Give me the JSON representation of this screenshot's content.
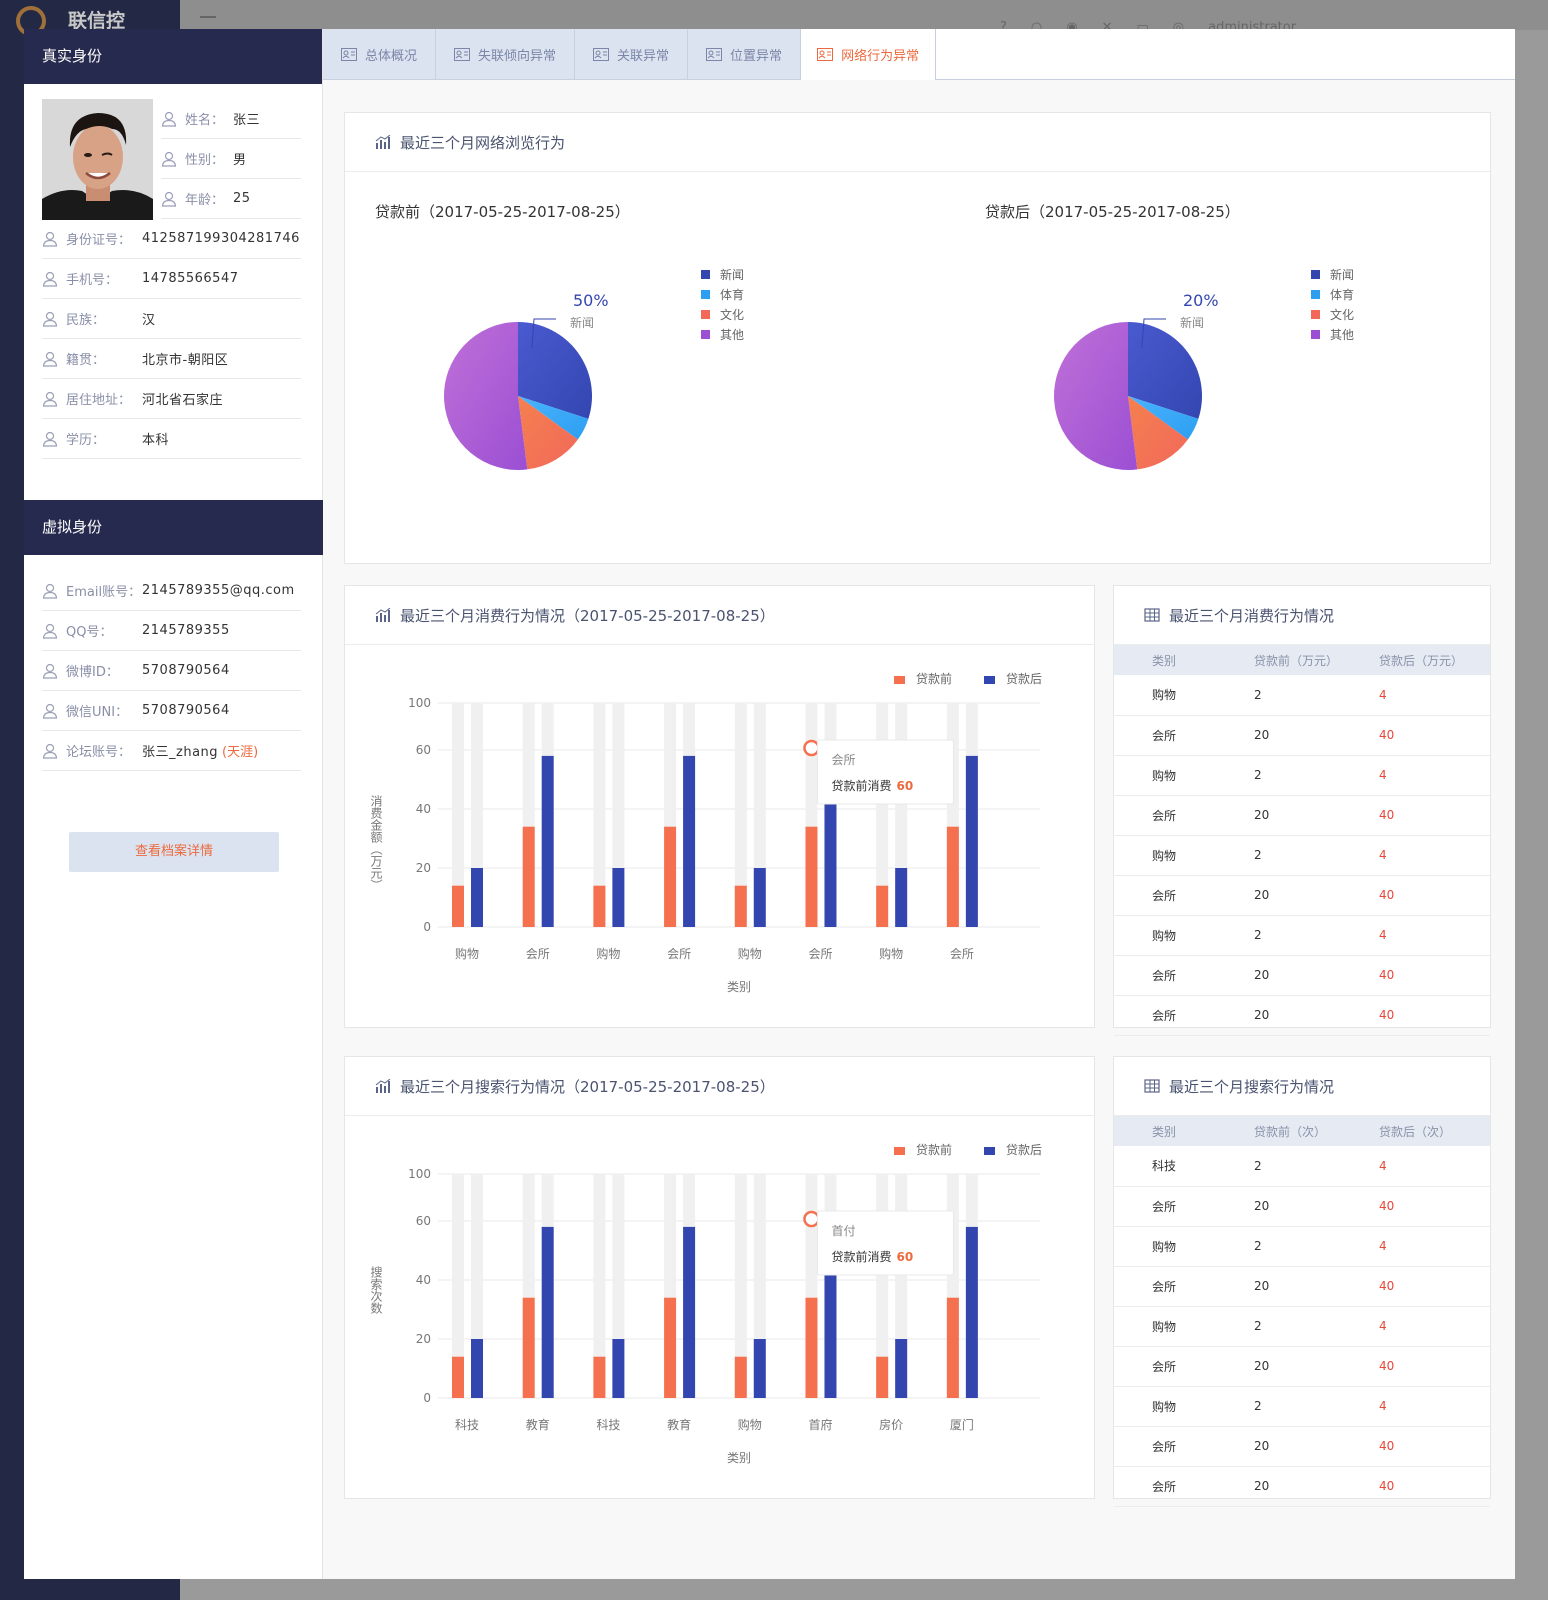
{
  "app": {
    "brand": "联信控",
    "user": "administrator"
  },
  "real_identity": {
    "title": "真实身份",
    "basic": [
      {
        "label": "姓名：",
        "value": "张三"
      },
      {
        "label": "性别：",
        "value": "男"
      },
      {
        "label": "年龄：",
        "value": "25"
      }
    ],
    "fields": [
      {
        "label": "身份证号：",
        "value": "412587199304281746"
      },
      {
        "label": "手机号：",
        "value": "14785566547"
      },
      {
        "label": "民族：",
        "value": "汉"
      },
      {
        "label": "籍贯：",
        "value": "北京市-朝阳区"
      },
      {
        "label": "居住地址：",
        "value": "河北省石家庄"
      },
      {
        "label": "学历：",
        "value": "本科"
      }
    ]
  },
  "virtual_identity": {
    "title": "虚拟身份",
    "fields": [
      {
        "label": "Email账号：",
        "value": "2145789355@qq.com"
      },
      {
        "label": "QQ号：",
        "value": "2145789355"
      },
      {
        "label": "微博ID：",
        "value": "5708790564"
      },
      {
        "label": "微信UNI：",
        "value": "5708790564"
      },
      {
        "label": "论坛账号：",
        "value": "张三_zhang",
        "extra": "(天涯)"
      }
    ]
  },
  "detail_button": "查看档案详情",
  "tabs": [
    {
      "label": "总体概况",
      "active": false
    },
    {
      "label": "失联倾向异常",
      "active": false
    },
    {
      "label": "关联异常",
      "active": false
    },
    {
      "label": "位置异常",
      "active": false
    },
    {
      "label": "网络行为异常",
      "active": true
    }
  ],
  "browse": {
    "title": "最近三个月网络浏览行为",
    "before_title": "贷款前（2017-05-25-2017-08-25）",
    "after_title": "贷款后（2017-05-25-2017-08-25）",
    "legend": [
      "新闻",
      "体育",
      "文化",
      "其他"
    ],
    "colors": [
      "#3346b0",
      "#2d9ef0",
      "#f2695a",
      "#9b4fd3"
    ],
    "before_label": {
      "pct": "50%",
      "name": "新闻"
    },
    "after_label": {
      "pct": "20%",
      "name": "新闻"
    }
  },
  "consume": {
    "title": "最近三个月消费行为情况（2017-05-25-2017-08-25）",
    "legend": [
      "贷款前",
      "贷款后"
    ],
    "ylabel": "消费金额（万元）",
    "xlabel": "类别",
    "tooltip": {
      "name": "会所",
      "label": "贷款前消费",
      "value": "60"
    },
    "table_title": "最近三个月消费行为情况",
    "table_headers": [
      "类别",
      "贷款前（万元）",
      "贷款后（万元）"
    ],
    "table_rows": [
      [
        "购物",
        "2",
        "4"
      ],
      [
        "会所",
        "20",
        "40"
      ],
      [
        "购物",
        "2",
        "4"
      ],
      [
        "会所",
        "20",
        "40"
      ],
      [
        "购物",
        "2",
        "4"
      ],
      [
        "会所",
        "20",
        "40"
      ],
      [
        "购物",
        "2",
        "4"
      ],
      [
        "会所",
        "20",
        "40"
      ],
      [
        "会所",
        "20",
        "40"
      ]
    ]
  },
  "search": {
    "title": "最近三个月搜索行为情况（2017-05-25-2017-08-25）",
    "legend": [
      "贷款前",
      "贷款后"
    ],
    "ylabel": "搜索次数",
    "xlabel": "类别",
    "tooltip": {
      "name": "首付",
      "label": "贷款前消费",
      "value": "60"
    },
    "table_title": "最近三个月搜索行为情况",
    "table_headers": [
      "类别",
      "贷款前（次）",
      "贷款后（次）"
    ],
    "table_rows": [
      [
        "科技",
        "2",
        "4"
      ],
      [
        "会所",
        "20",
        "40"
      ],
      [
        "购物",
        "2",
        "4"
      ],
      [
        "会所",
        "20",
        "40"
      ],
      [
        "购物",
        "2",
        "4"
      ],
      [
        "会所",
        "20",
        "40"
      ],
      [
        "购物",
        "2",
        "4"
      ],
      [
        "会所",
        "20",
        "40"
      ],
      [
        "会所",
        "20",
        "40"
      ]
    ]
  },
  "chart_data": [
    {
      "type": "pie",
      "title": "贷款前（2017-05-25-2017-08-25）",
      "categories": [
        "新闻",
        "体育",
        "文化",
        "其他"
      ],
      "values": [
        30,
        5,
        13,
        52
      ],
      "label_visible": "50% 新闻"
    },
    {
      "type": "pie",
      "title": "贷款后（2017-05-25-2017-08-25）",
      "categories": [
        "新闻",
        "体育",
        "文化",
        "其他"
      ],
      "values": [
        30,
        5,
        13,
        52
      ],
      "label_visible": "20% 新闻"
    },
    {
      "type": "bar",
      "title": "最近三个月消费行为情况（2017-05-25-2017-08-25）",
      "categories": [
        "购物",
        "会所",
        "购物",
        "会所",
        "购物",
        "会所",
        "购物",
        "会所"
      ],
      "series": [
        {
          "name": "贷款前",
          "values": [
            14,
            34,
            14,
            34,
            14,
            34,
            14,
            34
          ]
        },
        {
          "name": "贷款后",
          "values": [
            20,
            58,
            20,
            58,
            20,
            58,
            20,
            58
          ]
        }
      ],
      "yticks": [
        0,
        20,
        40,
        60,
        100
      ],
      "ylim": [
        0,
        100
      ],
      "xlabel": "类别",
      "ylabel": "消费金额（万元）"
    },
    {
      "type": "bar",
      "title": "最近三个月搜索行为情况（2017-05-25-2017-08-25）",
      "categories": [
        "科技",
        "教育",
        "科技",
        "教育",
        "购物",
        "首府",
        "房价",
        "厦门"
      ],
      "series": [
        {
          "name": "贷款前",
          "values": [
            14,
            34,
            14,
            34,
            14,
            34,
            14,
            34
          ]
        },
        {
          "name": "贷款后",
          "values": [
            20,
            58,
            20,
            58,
            20,
            58,
            20,
            58
          ]
        }
      ],
      "yticks": [
        0,
        20,
        40,
        60,
        100
      ],
      "ylim": [
        0,
        100
      ],
      "xlabel": "类别",
      "ylabel": "搜索次数"
    }
  ]
}
